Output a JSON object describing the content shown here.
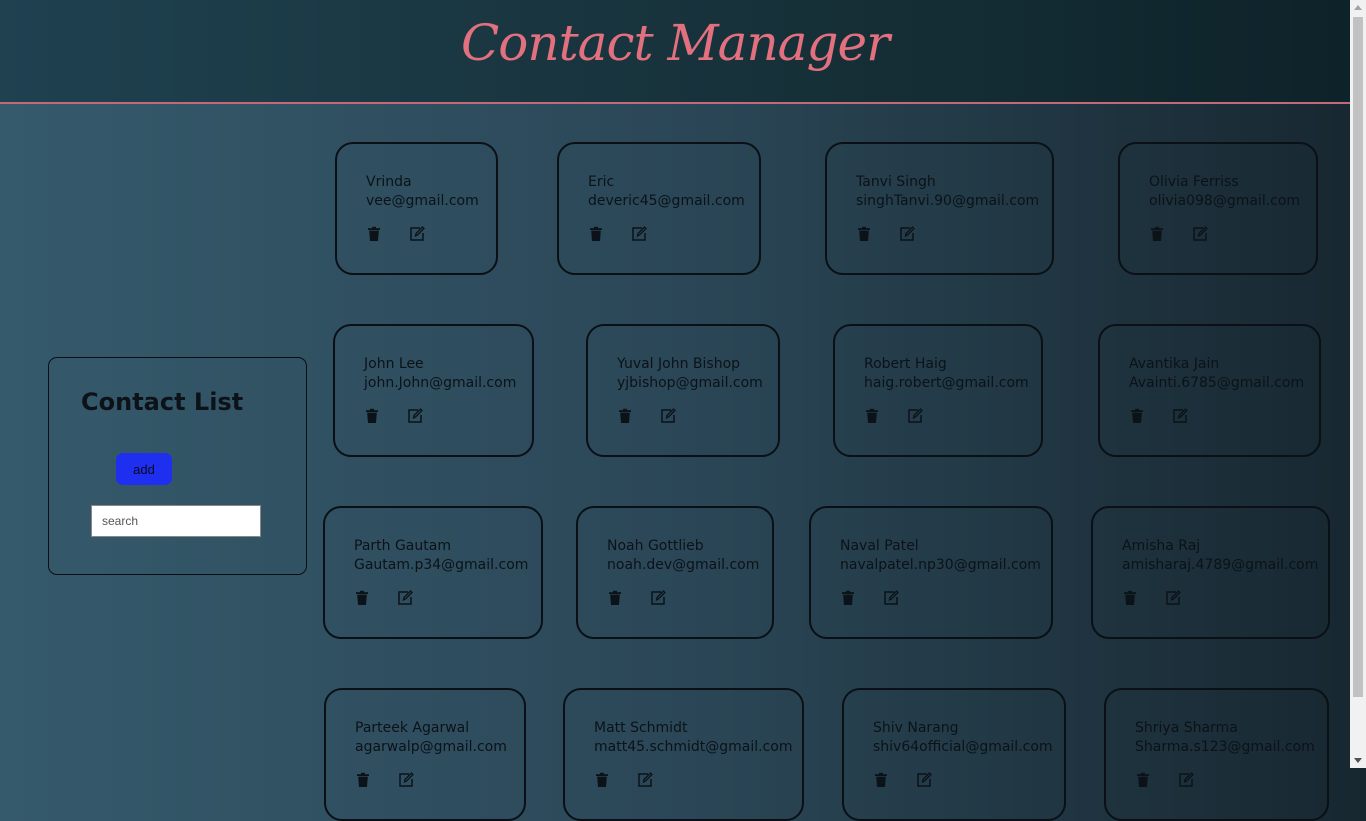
{
  "app": {
    "title": "Contact Manager"
  },
  "sidebar": {
    "heading": "Contact List",
    "add_label": "add",
    "search_placeholder": "search"
  },
  "contacts": [
    {
      "name": "Vrinda",
      "email": "vee@gmail.com"
    },
    {
      "name": "Eric",
      "email": "deveric45@gmail.com"
    },
    {
      "name": "Tanvi Singh",
      "email": "singhTanvi.90@gmail.com"
    },
    {
      "name": "Olivia Ferriss",
      "email": "olivia098@gmail.com"
    },
    {
      "name": "John Lee",
      "email": "john.John@gmail.com"
    },
    {
      "name": "Yuval John Bishop",
      "email": "yjbishop@gmail.com"
    },
    {
      "name": "Robert Haig",
      "email": "haig.robert@gmail.com"
    },
    {
      "name": "Avantika Jain",
      "email": "Avainti.6785@gmail.com"
    },
    {
      "name": "Parth Gautam",
      "email": "Gautam.p34@gmail.com"
    },
    {
      "name": "Noah Gottlieb",
      "email": "noah.dev@gmail.com"
    },
    {
      "name": "Naval Patel",
      "email": "navalpatel.np30@gmail.com"
    },
    {
      "name": "Amisha Raj",
      "email": "amisharaj.4789@gmail.com"
    },
    {
      "name": "Parteek Agarwal",
      "email": "agarwalp@gmail.com"
    },
    {
      "name": "Matt Schmidt",
      "email": "matt45.schmidt@gmail.com"
    },
    {
      "name": "Shiv Narang",
      "email": "shiv64official@gmail.com"
    },
    {
      "name": "Shriya Sharma",
      "email": "Sharma.s123@gmail.com"
    }
  ],
  "icons": {
    "delete": "trash-icon",
    "edit": "edit-icon"
  },
  "colors": {
    "accent": "#e2707f",
    "add_button": "#1e2ff0"
  }
}
